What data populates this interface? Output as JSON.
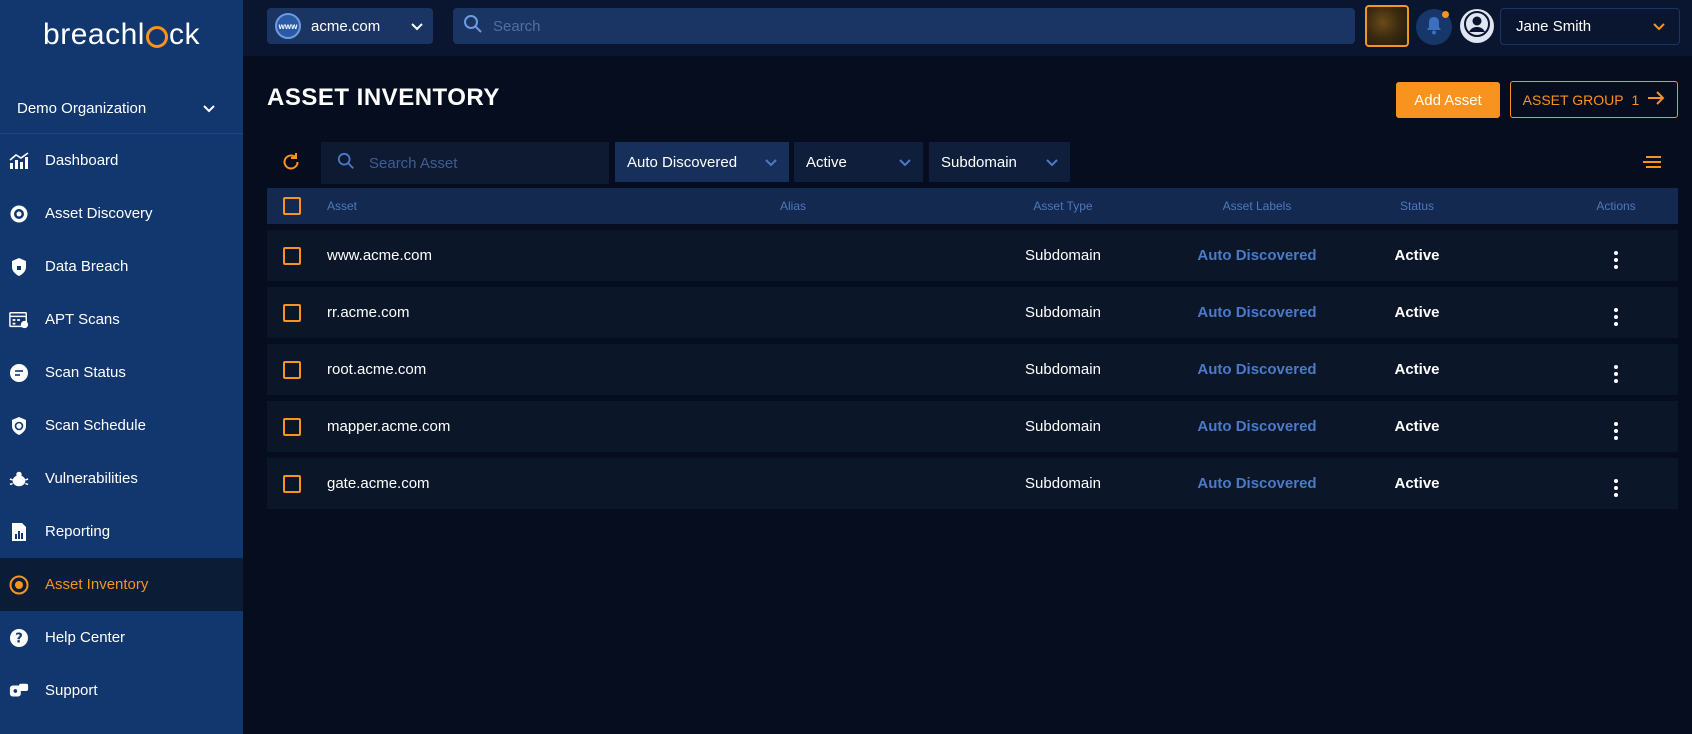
{
  "brand": {
    "logo_text_pre": "breachl",
    "logo_text_post": "ck"
  },
  "sidebar": {
    "org": "Demo Organization",
    "items": [
      {
        "label": "Dashboard",
        "icon": "chart-icon"
      },
      {
        "label": "Asset Discovery",
        "icon": "target-icon"
      },
      {
        "label": "Data Breach",
        "icon": "shield-lock-icon"
      },
      {
        "label": "APT Scans",
        "icon": "scan-calendar-icon"
      },
      {
        "label": "Scan Status",
        "icon": "status-icon"
      },
      {
        "label": "Scan Schedule",
        "icon": "schedule-shield-icon"
      },
      {
        "label": "Vulnerabilities",
        "icon": "bug-icon"
      },
      {
        "label": "Reporting",
        "icon": "report-icon"
      },
      {
        "label": "Asset Inventory",
        "icon": "inventory-icon",
        "active": true
      },
      {
        "label": "Help Center",
        "icon": "help-icon"
      },
      {
        "label": "Support",
        "icon": "support-icon"
      }
    ]
  },
  "topbar": {
    "domain": "acme.com",
    "domain_badge": "www",
    "search_placeholder": "Search",
    "user_name": "Jane Smith"
  },
  "page": {
    "title": "ASSET INVENTORY",
    "add_asset_label": "Add Asset",
    "asset_group_label": "ASSET GROUP",
    "asset_group_count": "1"
  },
  "filters": {
    "search_placeholder": "Search Asset",
    "label_filter": "Auto Discovered",
    "status_filter": "Active",
    "type_filter": "Subdomain"
  },
  "table": {
    "headers": {
      "asset": "Asset",
      "alias": "Alias",
      "type": "Asset Type",
      "labels": "Asset Labels",
      "status": "Status",
      "actions": "Actions"
    },
    "rows": [
      {
        "asset": "www.acme.com",
        "alias": "",
        "type": "Subdomain",
        "labels": "Auto Discovered",
        "status": "Active"
      },
      {
        "asset": "rr.acme.com",
        "alias": "",
        "type": "Subdomain",
        "labels": "Auto Discovered",
        "status": "Active"
      },
      {
        "asset": "root.acme.com",
        "alias": "",
        "type": "Subdomain",
        "labels": "Auto Discovered",
        "status": "Active"
      },
      {
        "asset": "mapper.acme.com",
        "alias": "",
        "type": "Subdomain",
        "labels": "Auto Discovered",
        "status": "Active"
      },
      {
        "asset": "gate.acme.com",
        "alias": "",
        "type": "Subdomain",
        "labels": "Auto Discovered",
        "status": "Active"
      }
    ]
  },
  "colors": {
    "accent": "#f7931e",
    "sidebar": "#12366e",
    "background": "#050d1e",
    "label_blue": "#4a7ac8"
  }
}
